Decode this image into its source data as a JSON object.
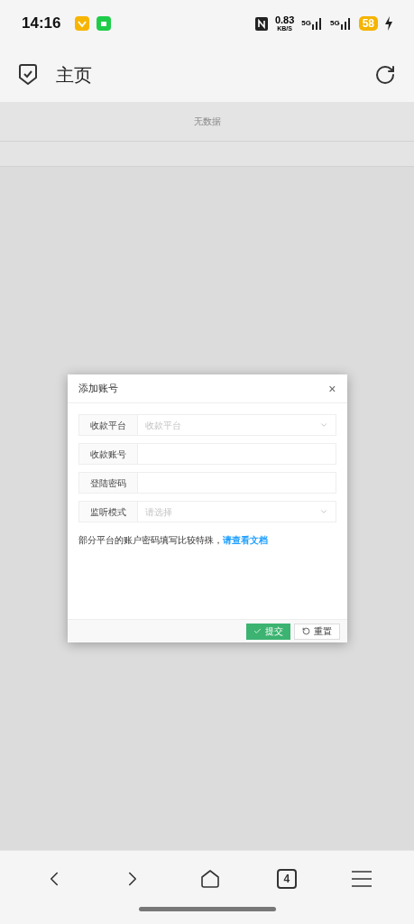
{
  "status_bar": {
    "time": "14:16",
    "speed_value": "0.83",
    "speed_unit": "KB/S",
    "network_1": "5G",
    "network_2": "5G",
    "battery": "58"
  },
  "header": {
    "title": "主页"
  },
  "table": {
    "empty_text": "无数据"
  },
  "dialog": {
    "title": "添加账号",
    "close": "×",
    "fields": [
      {
        "kind": "select",
        "label": "收款平台",
        "placeholder": "收款平台"
      },
      {
        "kind": "input",
        "label": "收款账号"
      },
      {
        "kind": "input",
        "label": "登陆密码"
      },
      {
        "kind": "select",
        "label": "监听模式",
        "placeholder": "请选择"
      }
    ],
    "hint": "部分平台的账户密码填写比较特殊，",
    "hint_link": "请查看文档",
    "buttons": [
      {
        "kind": "primary",
        "label": "提交"
      },
      {
        "kind": "secondary",
        "label": "重置"
      }
    ]
  },
  "bottom_nav": {
    "tabs_count": "4"
  }
}
